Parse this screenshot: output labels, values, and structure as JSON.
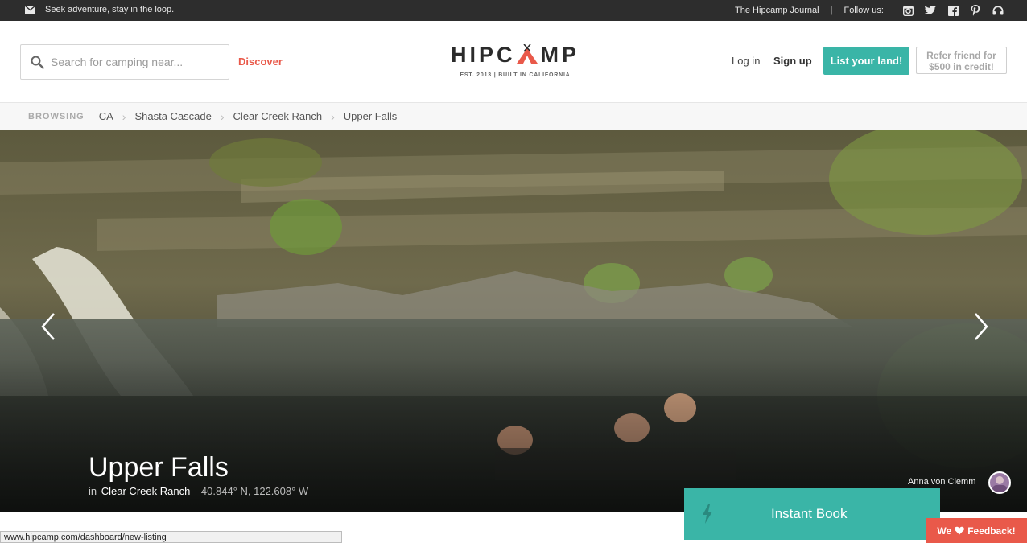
{
  "topbar": {
    "tagline": "Seek adventure, stay in the loop.",
    "journal_link": "The Hipcamp Journal",
    "separator": "|",
    "follow_label": "Follow us:",
    "social_icons": [
      "instagram-icon",
      "twitter-icon",
      "facebook-icon",
      "pinterest-icon",
      "podcast-icon"
    ]
  },
  "header": {
    "search_placeholder": "Search for camping near...",
    "discover_label": "Discover",
    "logo": {
      "left": "HIPC",
      "right": "MP",
      "tagline": "EST. 2013 | BUILT IN CALIFORNIA"
    },
    "login_label": "Log in",
    "signup_label": "Sign up",
    "list_land_label": "List your land!",
    "refer_line1": "Refer friend for",
    "refer_line2": "$500 in credit!"
  },
  "breadcrumb": {
    "label": "BROWSING",
    "items": [
      "CA",
      "Shasta Cascade",
      "Clear Creek Ranch",
      "Upper Falls"
    ]
  },
  "hero": {
    "title": "Upper Falls",
    "in_label": "in",
    "ranch": "Clear Creek Ranch",
    "coords": "40.844° N, 122.608° W",
    "photo_credit": "Anna von Clemm"
  },
  "instant_book_label": "Instant Book",
  "feedback": {
    "prefix": "We",
    "suffix": "Feedback!"
  },
  "status_url": "www.hipcamp.com/dashboard/new-listing",
  "colors": {
    "accent_teal": "#3ab5a7",
    "accent_red": "#e9594a",
    "topbar_bg": "#2d2d2d"
  }
}
